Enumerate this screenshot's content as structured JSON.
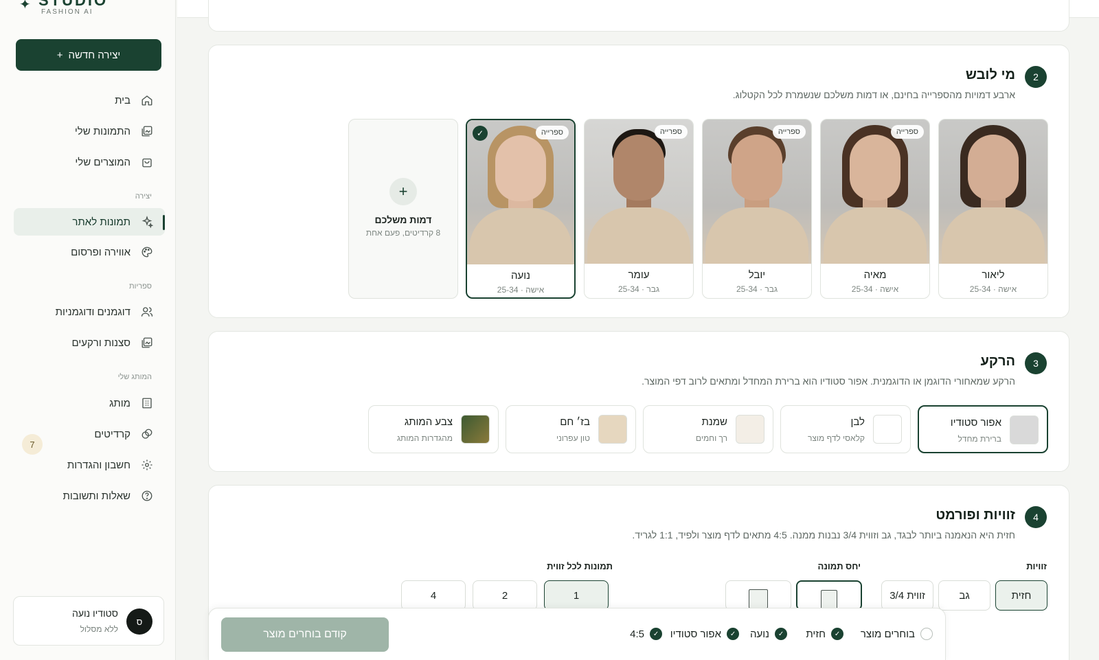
{
  "brand": {
    "name": "STUDIO",
    "sub": "FASHION AI"
  },
  "sidebar": {
    "create_label": "יצירה חדשה",
    "items": [
      {
        "label": "בית"
      },
      {
        "label": "התמונות שלי"
      },
      {
        "label": "המוצרים שלי"
      },
      {
        "label": "תמונות לאתר"
      },
      {
        "label": "אווירה ופרסום"
      },
      {
        "label": "דוגמנים ודוגמניות"
      },
      {
        "label": "סצנות ורקעים"
      },
      {
        "label": "מותג"
      },
      {
        "label": "קרדיטים"
      },
      {
        "label": "חשבון והגדרות"
      },
      {
        "label": "שאלות ותשובות"
      }
    ],
    "sections": {
      "create": "יצירה",
      "libraries": "ספריות",
      "brand": "המותג שלי"
    },
    "credits_badge": "7",
    "user": {
      "avatar": "ס",
      "name": "סטודיו נועה",
      "plan": "ללא מסלול"
    }
  },
  "who": {
    "step": "2",
    "title": "מי לובש",
    "desc": "ארבע דמויות מהספרייה בחינם, או דמות משלכם שנשמרת לכל הקטלוג.",
    "library_tag": "ספרייה",
    "models": [
      {
        "name": "ליאור",
        "meta": "אישה · 25-34"
      },
      {
        "name": "מאיה",
        "meta": "אישה · 25-34"
      },
      {
        "name": "יובל",
        "meta": "גבר · 25-34"
      },
      {
        "name": "עומר",
        "meta": "גבר · 25-34"
      },
      {
        "name": "נועה",
        "meta": "אישה · 25-34"
      }
    ],
    "custom": {
      "title": "דמות משלכם",
      "sub": "8 קרדיטים, פעם אחת"
    }
  },
  "background": {
    "step": "3",
    "title": "הרקע",
    "desc": "הרקע שמאחורי הדוגמן או הדוגמנית. אפור סטודיו הוא ברירת המחדל ומתאים לרוב דפי המוצר.",
    "options": [
      {
        "name": "אפור סטודיו",
        "sub": "ברירת מחדל",
        "color": "#d9d9d9"
      },
      {
        "name": "לבן",
        "sub": "קלאסי לדף מוצר",
        "color": "#ffffff"
      },
      {
        "name": "שמנת",
        "sub": "רך וחמים",
        "color": "#f3eee6"
      },
      {
        "name": "בז׳ חם",
        "sub": "טון עפרוני",
        "color": "#e6d7bf"
      },
      {
        "name": "צבע המותג",
        "sub": "מהגדרות המותג",
        "color": "#3d5a32"
      }
    ]
  },
  "angles": {
    "step": "4",
    "title": "זוויות ופורמט",
    "desc": "חזית היא הנאמנה ביותר לבגד, גב וזווית 3/4 נבנות ממנה. 4:5 מתאים לדף מוצר ולפיד, 1:1 לגריד.",
    "angles_label": "זוויות",
    "angle_options": [
      "חזית",
      "גב",
      "זווית 3/4"
    ],
    "ratio_label": "יחס תמונה",
    "count_label": "תמונות לכל זווית",
    "count_options": [
      "1",
      "2",
      "4"
    ]
  },
  "bottom": {
    "cta": "קודם בוחרים מוצר",
    "chips": [
      "בוחרים מוצר",
      "חזית",
      "נועה",
      "אפור סטודיו",
      "4:5"
    ]
  },
  "colors": {
    "accent": "#1a4231"
  }
}
